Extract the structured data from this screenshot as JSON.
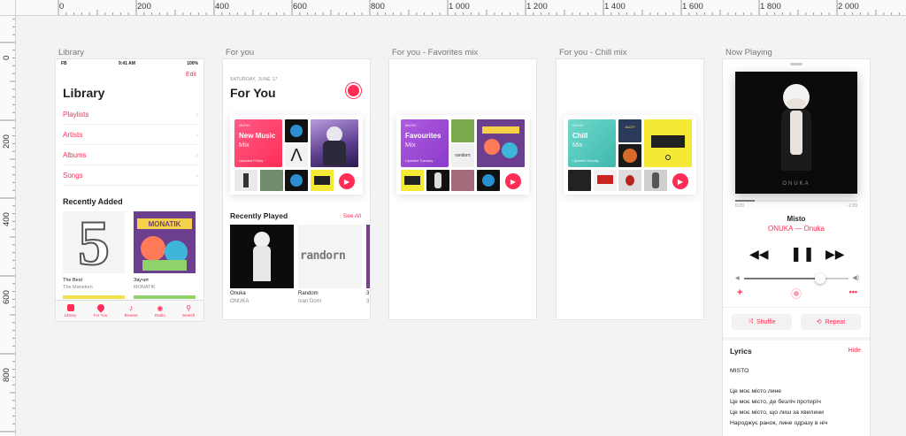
{
  "ruler": {
    "top_labels": [
      "0",
      "200",
      "400",
      "600",
      "800",
      "1 000",
      "1 200",
      "1 400",
      "1 600",
      "1 800",
      "2 000"
    ],
    "left_labels": [
      "0",
      "200",
      "400",
      "600",
      "800"
    ]
  },
  "artboards": {
    "library": "Library",
    "for_you": "For you",
    "favorites_mix": "For you - Favorites mix",
    "chill_mix": "For you - Chill mix",
    "now_playing": "Now Playing"
  },
  "library": {
    "status": {
      "carrier": "FB",
      "time": "9:41 AM",
      "battery": "100%"
    },
    "edit_label": "Edit",
    "title": "Library",
    "rows": [
      "Playlists",
      "Artists",
      "Albums",
      "Songs"
    ],
    "recently_added_title": "Recently Added",
    "albums": [
      {
        "name": "The Best",
        "artist": "The Maneken"
      },
      {
        "name": "Звучит",
        "artist": "MONATIK"
      }
    ],
    "tabs": [
      "Library",
      "For You",
      "Browse",
      "Radio",
      "Search"
    ]
  },
  "for_you": {
    "date": "SATURDAY, JUNE 17",
    "title": "For You",
    "new_music": {
      "brand": "MUSIC",
      "name": "New Music",
      "sub": "Mix",
      "updated": "Updated Friday"
    },
    "recently_played_title": "Recently Played",
    "see_all": "See All",
    "recent": [
      {
        "name": "Onuka",
        "artist": "ONUKA"
      },
      {
        "name": "Random",
        "artist": "Ivan Dorn"
      },
      {
        "name": "3",
        "artist": "3"
      }
    ]
  },
  "favorites_mix": {
    "brand": "MUSIC",
    "name": "Favourites",
    "sub": "Mix",
    "updated": "Updated Tuesday"
  },
  "chill_mix": {
    "brand": "MUSIC",
    "name": "Chill",
    "sub": "Mix",
    "updated": "Updated Sunday"
  },
  "now_playing": {
    "cover_text": "ONUKA",
    "time_elapsed": "0:20",
    "time_left": "-1:09",
    "title": "Misto",
    "artist": "ONUKA — Onuka",
    "shuffle": "Shuffle",
    "repeat": "Repeat",
    "lyrics_title": "Lyrics",
    "lyrics_hide": "Hide",
    "lyrics_heading": "MISTO",
    "lyrics_lines": [
      "Це моє місто лине",
      "Це моє місто, де безліч протирїч",
      "Це моє місто, що лиш за хвилини",
      "Народжує ранок, лине одразу в ніч"
    ]
  },
  "colors": {
    "accent": "#ff2d55",
    "new_music": "#ff3b6b",
    "favourites": "#9b45d6",
    "chill": "#58cfc4"
  }
}
